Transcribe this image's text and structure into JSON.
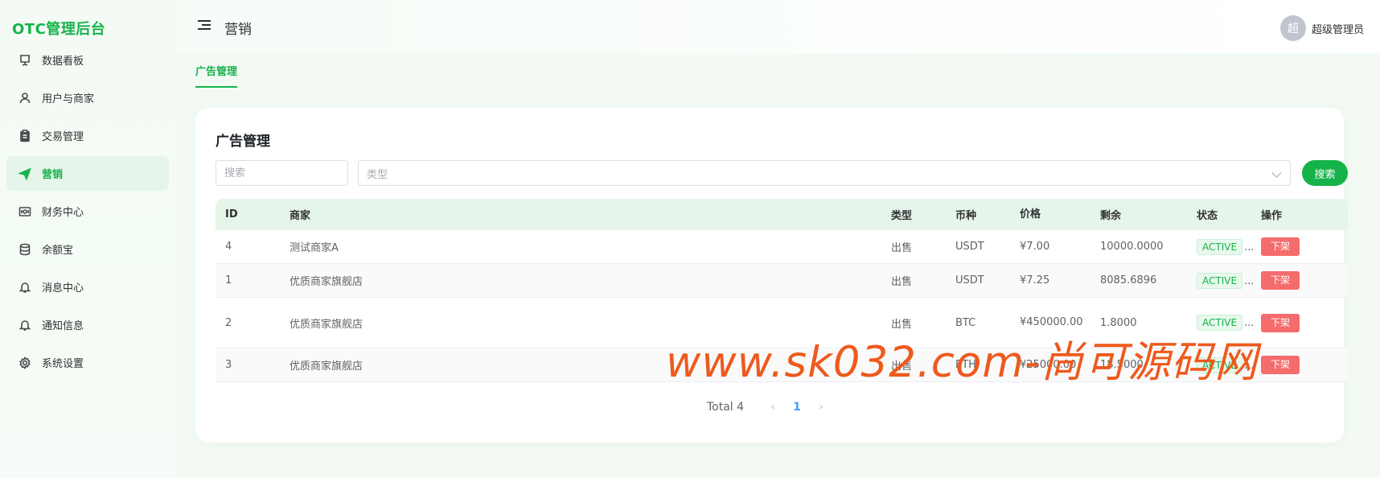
{
  "app": {
    "logo": "OTC管理后台"
  },
  "sidebar": {
    "items": [
      {
        "label": "数据看板",
        "icon": "dashboard-icon"
      },
      {
        "label": "用户与商家",
        "icon": "user-icon"
      },
      {
        "label": "交易管理",
        "icon": "clipboard-icon"
      },
      {
        "label": "营销",
        "icon": "send-icon",
        "active": true
      },
      {
        "label": "财务中心",
        "icon": "wallet-icon"
      },
      {
        "label": "余额宝",
        "icon": "database-icon"
      },
      {
        "label": "消息中心",
        "icon": "bell-icon"
      },
      {
        "label": "通知信息",
        "icon": "bell-icon"
      },
      {
        "label": "系统设置",
        "icon": "gear-icon"
      }
    ]
  },
  "header": {
    "title": "营销",
    "user": {
      "avatar": "超",
      "name": "超级管理员"
    }
  },
  "tabs": [
    {
      "label": "广告管理"
    }
  ],
  "card": {
    "title": "广告管理",
    "search": {
      "placeholder": "搜索"
    },
    "type_select": {
      "placeholder": "类型"
    },
    "search_button": "搜索",
    "columns": [
      "ID",
      "商家",
      "类型",
      "币种",
      "价格",
      "剩余",
      "状态",
      "操作"
    ],
    "rows": [
      {
        "id": "4",
        "merchant": "测试商家A",
        "type": "出售",
        "coin": "USDT",
        "price": "¥7.00",
        "remain": "10000.0000",
        "status": "ACTIVE",
        "action": "下架"
      },
      {
        "id": "1",
        "merchant": "优质商家旗舰店",
        "type": "出售",
        "coin": "USDT",
        "price": "¥7.25",
        "remain": "8085.6896",
        "status": "ACTIVE",
        "action": "下架"
      },
      {
        "id": "2",
        "merchant": "优质商家旗舰店",
        "type": "出售",
        "coin": "BTC",
        "price": "¥450000.00",
        "remain": "1.8000",
        "status": "ACTIVE",
        "action": "下架"
      },
      {
        "id": "3",
        "merchant": "优质商家旗舰店",
        "type": "出售",
        "coin": "ETH",
        "price": "¥25000.00",
        "remain": "18.5000",
        "status": "ACTIVE",
        "action": "下架"
      }
    ],
    "pagination": {
      "total": "Total 4",
      "current": "1",
      "prev": "‹",
      "next": "›"
    }
  },
  "watermark": "www.sk032.com-尚可源码网",
  "colors": {
    "accent": "#16b34a",
    "danger": "#f56c6c",
    "link": "#409eff"
  }
}
